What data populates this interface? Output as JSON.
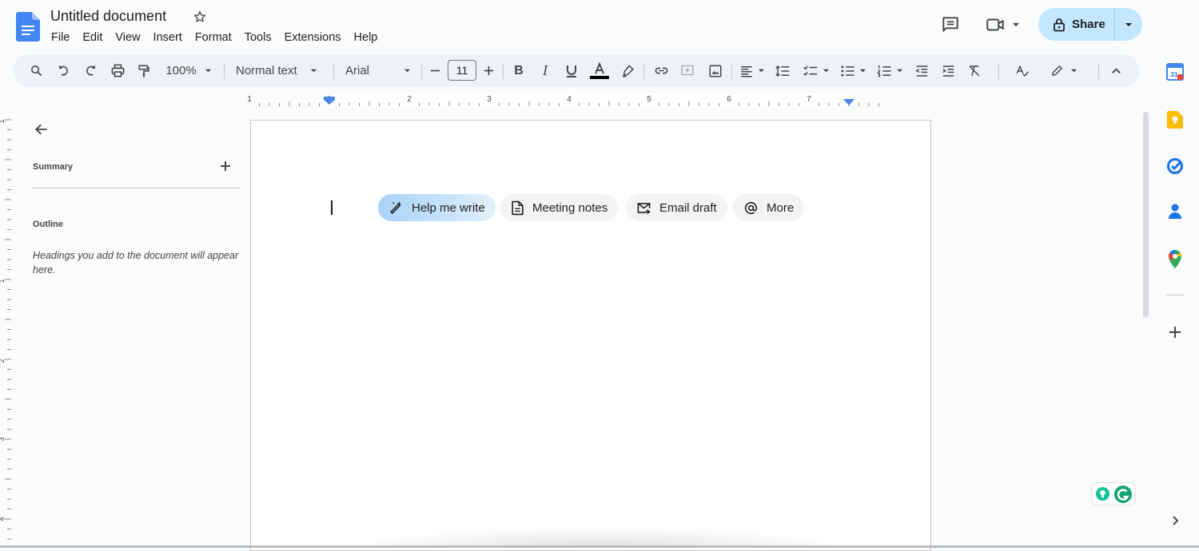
{
  "header": {
    "doc_title": "Untitled document",
    "menu": [
      "File",
      "Edit",
      "View",
      "Insert",
      "Format",
      "Tools",
      "Extensions",
      "Help"
    ],
    "share_label": "Share"
  },
  "toolbar": {
    "zoom": "100%",
    "style": "Normal text",
    "font": "Arial",
    "font_size": "11"
  },
  "ruler": {
    "labels": [
      "1",
      "1",
      "2",
      "3",
      "4",
      "5",
      "6",
      "7"
    ],
    "vlabels": [
      "1",
      "1",
      "2",
      "3",
      "4"
    ]
  },
  "sidebar": {
    "summary_label": "Summary",
    "outline_label": "Outline",
    "outline_hint": "Headings you add to the document will appear here."
  },
  "chips": {
    "help": "Help me write",
    "meeting": "Meeting notes",
    "email": "Email draft",
    "more": "More"
  },
  "side_apps": {
    "calendar_day": "31",
    "icons": [
      "calendar-icon",
      "keep-icon",
      "tasks-icon",
      "contacts-icon",
      "maps-icon",
      "add-icon"
    ]
  },
  "colors": {
    "accent": "#1a73e8",
    "share_bg": "#c2e7ff",
    "toolbar_bg": "#edf2fa"
  }
}
